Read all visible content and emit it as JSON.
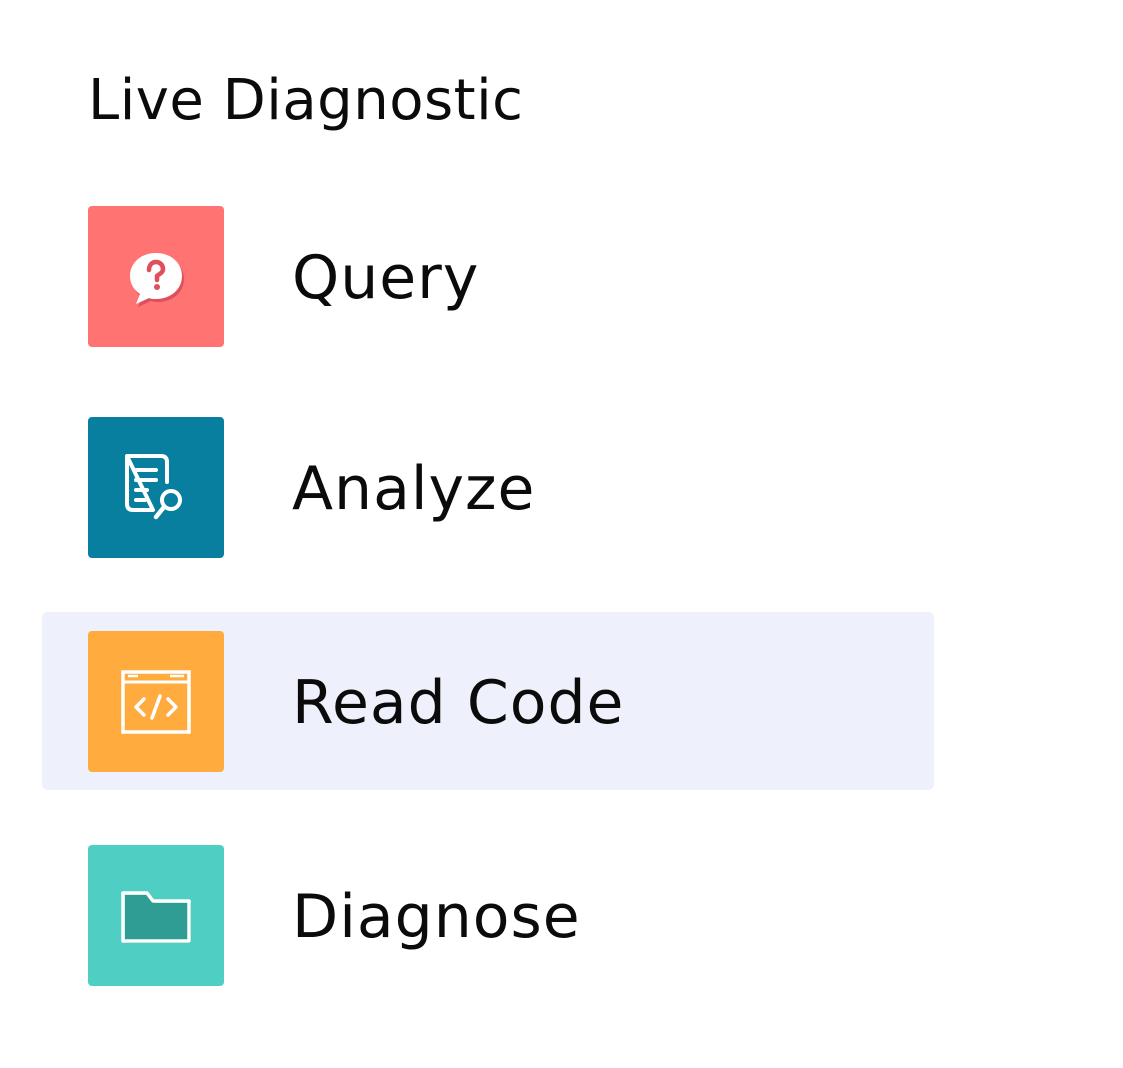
{
  "panel": {
    "title": "Live Diagnostic"
  },
  "menu": {
    "items": [
      {
        "label": "Query",
        "icon": "question-bubble-icon",
        "color": "#ff7373",
        "selected": false
      },
      {
        "label": "Analyze",
        "icon": "document-search-icon",
        "color": "#087f9e",
        "selected": false
      },
      {
        "label": "Read Code",
        "icon": "code-window-icon",
        "color": "#ffab3e",
        "selected": true
      },
      {
        "label": "Diagnose",
        "icon": "folder-icon",
        "color": "#4fcfc3",
        "selected": false
      }
    ],
    "selected_background": "#eef0fc"
  }
}
